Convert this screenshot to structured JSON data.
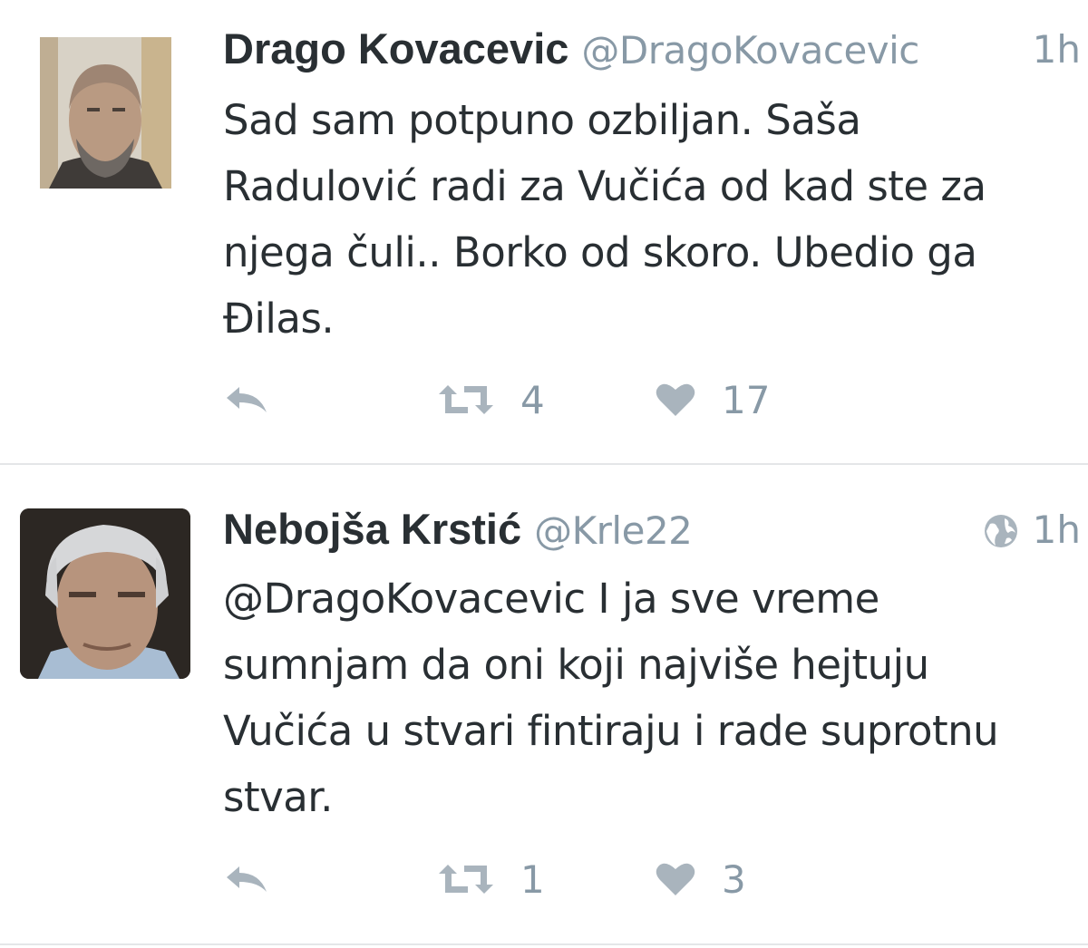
{
  "colors": {
    "text": "#292f33",
    "muted": "#8899a6",
    "divider": "#e4e6e8",
    "icon": "#a9b4bd"
  },
  "tweets": [
    {
      "name": "Drago Kovacevic",
      "handle": "@DragoKovacevic",
      "time": "1h",
      "text": "Sad sam potpuno ozbiljan. Saša\nRadulović radi za Vučića od kad ste za\nnjega čuli.. Borko od skoro. Ubedio ga\nĐilas.",
      "retweets": "4",
      "likes": "17",
      "icons": [
        "reply-icon",
        "retweet-icon",
        "heart-icon"
      ]
    },
    {
      "name": "Nebojša Krstić",
      "handle": "@Krle22",
      "time": "1h",
      "text": "@DragoKovacevic I ja sve vreme\nsumnjam da oni koji najviše hejtuju\nVučića u stvari fintiraju i rade suprotnu\nstvar.",
      "retweets": "1",
      "likes": "3",
      "icons": [
        "globe-icon",
        "reply-icon",
        "retweet-icon",
        "heart-icon"
      ]
    }
  ]
}
